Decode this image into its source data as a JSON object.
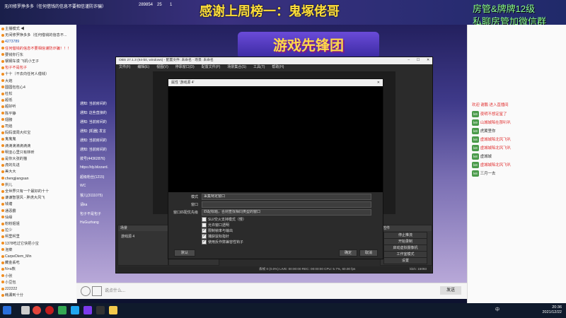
{
  "header": {
    "title": "无间修罗挣多多（任何借钱的信息不要相信谨防诈骗）",
    "stats": [
      "289854",
      "25",
      "1"
    ],
    "banner_main": "感谢上周榜一：鬼塚佬哥",
    "banner_right1": "房管&牌牌12级",
    "banner_right2": "私聊房管加微信群"
  },
  "stage": {
    "logo": "游戏先锋团"
  },
  "left_panel": {
    "rows": [
      {
        "text": "主播模式 ◀",
        "style": "normal"
      },
      {
        "text": "无间修罗挣多多（任何借钱的信息不...",
        "style": "normal"
      },
      {
        "text": "4273789",
        "style": "blue"
      },
      {
        "text": "任何借钱的信息不要相信谨防诈骗！！！",
        "style": "red"
      },
      {
        "text": "要钱你行东",
        "style": "normal"
      },
      {
        "text": "钢钢车漠 飞机小王子",
        "style": "normal"
      },
      {
        "text": "包子不是包子",
        "style": "red"
      },
      {
        "text": "十十（不去向任何人借钱）",
        "style": "normal"
      },
      {
        "text": "大炮",
        "style": "normal"
      },
      {
        "text": "圆圆包包心4",
        "style": "normal"
      },
      {
        "text": "杜松",
        "style": "normal"
      },
      {
        "text": "超低",
        "style": "normal"
      },
      {
        "text": "超好听",
        "style": "normal"
      },
      {
        "text": "陈平静",
        "style": "normal"
      },
      {
        "text": "翅膀",
        "style": "normal"
      },
      {
        "text": "司焰",
        "style": "normal"
      },
      {
        "text": "妈妈漠周大红宝",
        "style": "normal"
      },
      {
        "text": "鬼鬼鬼",
        "style": "normal"
      },
      {
        "text": "滴滴滴滴滴滴滴",
        "style": "normal"
      },
      {
        "text": "明亚心里只有林昕",
        "style": "normal"
      },
      {
        "text": "是你大张的猫",
        "style": "normal"
      },
      {
        "text": "虎的先进",
        "style": "normal"
      },
      {
        "text": "美大大",
        "style": "normal"
      },
      {
        "text": "chengjiangsan",
        "style": "normal"
      },
      {
        "text": "拱儿",
        "style": "normal"
      },
      {
        "text": "全世界只有一个最好的十十",
        "style": "normal"
      },
      {
        "text": "谦谦智慧风 - 胖虎大风飞",
        "style": "normal"
      },
      {
        "text": "钱塘",
        "style": "normal"
      },
      {
        "text": "通恶霸",
        "style": "normal"
      },
      {
        "text": "仙缘",
        "style": "normal"
      },
      {
        "text": "粉粉姐姐",
        "style": "normal"
      },
      {
        "text": "拉少",
        "style": "normal"
      },
      {
        "text": "柯里柯里",
        "style": "normal"
      },
      {
        "text": "1378吃过它快把小宝",
        "style": "normal"
      },
      {
        "text": "泡菜",
        "style": "normal"
      },
      {
        "text": "CarpeDiem_Min",
        "style": "normal"
      },
      {
        "text": "藏金丢吃",
        "style": "normal"
      },
      {
        "text": "N+a熊",
        "style": "normal"
      },
      {
        "text": "小张",
        "style": "normal"
      },
      {
        "text": "小豆包",
        "style": "normal"
      },
      {
        "text": "222222",
        "style": "normal"
      },
      {
        "text": "韩漏到十分",
        "style": "normal"
      }
    ]
  },
  "obs": {
    "title": "OBS 27.1.3 (64-bit, windows) - 配置文件: 未命名 - 场景: 未命名",
    "menu": [
      "文件(F)",
      "编辑(E)",
      "视图(V)",
      "停靠窗口(D)",
      "配置文件(P)",
      "场景集合(S)",
      "工具(T)",
      "帮助(H)"
    ],
    "scene_panel_title": "场景",
    "sources_panel_title": "来源",
    "controls_title": "控件",
    "controls": [
      "停止推流",
      "开始录制",
      "启动虚拟摄像机",
      "工作室模式",
      "设置",
      "退出"
    ],
    "source_item": "游戏源 4",
    "status_bar": "丢帧 0 (0.0%)   LIVE: 00:00:00   REC: 00:00:00   CPU: 5.7%, 60.00 fps",
    "kbps": "kb/s: 15093"
  },
  "dialog": {
    "title": "属性 '游戏源 4'",
    "mode_label": "模式",
    "mode_value": "采集特定窗口",
    "window_label": "窗口",
    "window_value": "",
    "priority_label": "窗口匹配优先级",
    "priority_value": "匹配标题，否则查找相同类型的窗口",
    "checks": [
      {
        "label": "SLI/交火支持模式（慢）",
        "checked": false
      },
      {
        "label": "允许窗口透明",
        "checked": false
      },
      {
        "label": "限制帧率与输出",
        "checked": true
      },
      {
        "label": "捕获鼠标指针",
        "checked": true
      },
      {
        "label": "使用反作弊兼容性钩子",
        "checked": true
      }
    ],
    "defaults_button": "默认",
    "ok_button": "确定",
    "cancel_button": "取消"
  },
  "chat": {
    "lines": [
      "通知: 当前房间的",
      "通知: 这些直接的",
      "通知: 当前房间的",
      "通知: [机器] 发言",
      "通知: 当前房间的",
      "通知: 当前房间的",
      "拨号(44362876)",
      "https://dy.blizzard.",
      "超级粉丝(1215)",
      "WC",
      "猴儿(3111075)",
      "请ka",
      "包子不是包子",
      "HuGuzhang"
    ]
  },
  "right_panel": {
    "rows": [
      {
        "tag": "",
        "text": "欢迎 谢鹏 进入直播间",
        "style": "alert"
      },
      {
        "tag": "lv9",
        "text": "夜明不想定星了",
        "style": "alert"
      },
      {
        "tag": "lv9",
        "text": "山城城陷在那叭叭",
        "style": "alert"
      },
      {
        "tag": "lv9",
        "text": "虎翼里你",
        "style": "normal"
      },
      {
        "tag": "lv8",
        "text": "虚城城陷北风飞叭",
        "style": "alert"
      },
      {
        "tag": "lv8",
        "text": "虚城城陷北风飞叭",
        "style": "alert"
      },
      {
        "tag": "lv8",
        "text": "虚城城",
        "style": "normal"
      },
      {
        "tag": "lv8",
        "text": "虚城城陷北风飞叭",
        "style": "alert"
      },
      {
        "tag": "lv8",
        "text": "三月一去",
        "style": "normal"
      }
    ]
  },
  "input": {
    "placeholder": "说点什么...",
    "send": "发送"
  },
  "taskbar": {
    "time": "20:36",
    "date": "2021/12/22",
    "lang": "中"
  },
  "colors": {
    "banner_yellow": "#ffde3a",
    "banner_green": "#8cff8c",
    "alert_red": "#e03030"
  }
}
